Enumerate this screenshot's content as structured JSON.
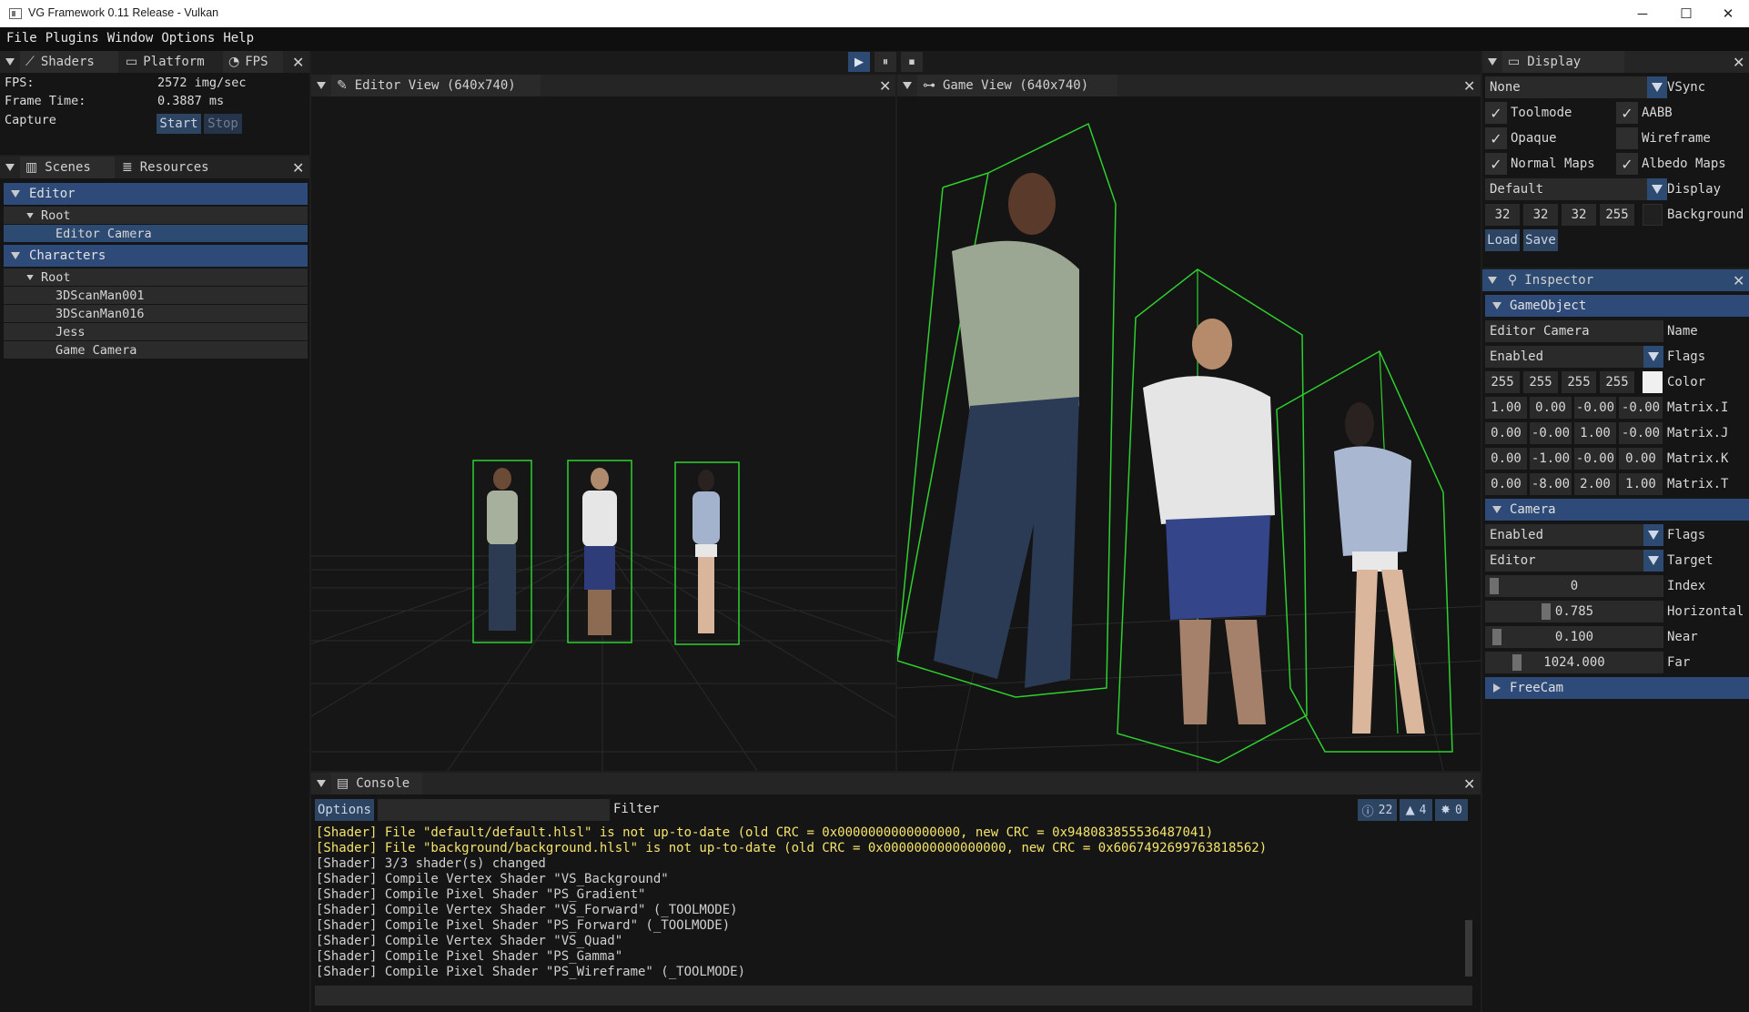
{
  "window": {
    "title": "VG Framework 0.11 Release - Vulkan",
    "minimize": "─",
    "maximize": "☐",
    "close": "✕"
  },
  "menu": [
    "File",
    "Plugins",
    "Window",
    "Options",
    "Help"
  ],
  "playbar": {
    "play": "▶",
    "pause": "⏸",
    "stop": "⏹"
  },
  "stats_panel": {
    "tabs": [
      "Shaders",
      "Platform",
      "FPS"
    ],
    "fps_label": "FPS:",
    "fps_value": "2572 img/sec",
    "frame_label": "Frame Time:",
    "frame_value": "0.3887 ms",
    "capture_label": "Capture",
    "start": "Start",
    "stop": "Stop"
  },
  "scenes_panel": {
    "tabs": [
      "Scenes",
      "Resources"
    ],
    "groups": [
      {
        "name": "Editor",
        "root": "Root",
        "items": [
          "Editor Camera"
        ]
      },
      {
        "name": "Characters",
        "root": "Root",
        "items": [
          "3DScanMan001",
          "3DScanMan016",
          "Jess",
          "Game Camera"
        ]
      }
    ]
  },
  "editor_view": {
    "title": "Editor View (640x740)"
  },
  "game_view": {
    "title": "Game View (640x740)"
  },
  "console": {
    "title": "Console",
    "options": "Options",
    "filter_label": "Filter",
    "filter_value": "",
    "counts": {
      "info": "22",
      "warning": "4",
      "error": "0"
    },
    "lines": [
      {
        "text": "[Shader] File \"default/default.hlsl\" is not up-to-date (old CRC = 0x0000000000000000, new CRC = 0x948083855536487041)",
        "level": "warning"
      },
      {
        "text": "[Shader] File \"background/background.hlsl\" is not up-to-date (old CRC = 0x0000000000000000, new CRC = 0x6067492699763818562)",
        "level": "warning"
      },
      {
        "text": "[Shader] 3/3 shader(s) changed",
        "level": "info"
      },
      {
        "text": "[Shader] Compile Vertex Shader \"VS_Background\"",
        "level": "info"
      },
      {
        "text": "[Shader] Compile Pixel Shader \"PS_Gradient\"",
        "level": "info"
      },
      {
        "text": "[Shader] Compile Vertex Shader \"VS_Forward\" (_TOOLMODE)",
        "level": "info"
      },
      {
        "text": "[Shader] Compile Pixel Shader \"PS_Forward\" (_TOOLMODE)",
        "level": "info"
      },
      {
        "text": "[Shader] Compile Vertex Shader \"VS_Quad\"",
        "level": "info"
      },
      {
        "text": "[Shader] Compile Pixel Shader \"PS_Gamma\"",
        "level": "info"
      },
      {
        "text": "[Shader] Compile Pixel Shader \"PS_Wireframe\" (_TOOLMODE)",
        "level": "info"
      }
    ]
  },
  "display_panel": {
    "title": "Display",
    "vsync_value": "None",
    "vsync_label": "VSync",
    "toolmode": "Toolmode",
    "aabb": "AABB",
    "opaque": "Opaque",
    "wireframe": "Wireframe",
    "normal_maps": "Normal Maps",
    "albedo_maps": "Albedo Maps",
    "display_value": "Default",
    "display_label": "Display",
    "bg": [
      "32",
      "32",
      "32",
      "255"
    ],
    "bg_label": "Background",
    "bg_color": "#202020",
    "load": "Load",
    "save": "Save"
  },
  "inspector": {
    "title": "Inspector",
    "gameobject_header": "GameObject",
    "name_value": "Editor Camera",
    "name_label": "Name",
    "flags_value": "Enabled",
    "flags_label": "Flags",
    "color": [
      "255",
      "255",
      "255",
      "255"
    ],
    "color_label": "Color",
    "color_swatch": "#f0f0f0",
    "matrix": [
      {
        "vals": [
          "1.00",
          "0.00",
          "-0.00",
          "-0.00"
        ],
        "label": "Matrix.I"
      },
      {
        "vals": [
          "0.00",
          "-0.00",
          "1.00",
          "-0.00"
        ],
        "label": "Matrix.J"
      },
      {
        "vals": [
          "0.00",
          "-1.00",
          "-0.00",
          "0.00"
        ],
        "label": "Matrix.K"
      },
      {
        "vals": [
          "0.00",
          "-8.00",
          "2.00",
          "1.00"
        ],
        "label": "Matrix.T"
      }
    ],
    "camera_header": "Camera",
    "cam_flags_value": "Enabled",
    "cam_flags_label": "Flags",
    "target_value": "Editor",
    "target_label": "Target",
    "index_value": "0",
    "index_label": "Index",
    "horizontal_value": "0.785",
    "horizontal_label": "Horizontal",
    "near_value": "0.100",
    "near_label": "Near",
    "far_value": "1024.000",
    "far_label": "Far",
    "freecam_header": "FreeCam"
  }
}
